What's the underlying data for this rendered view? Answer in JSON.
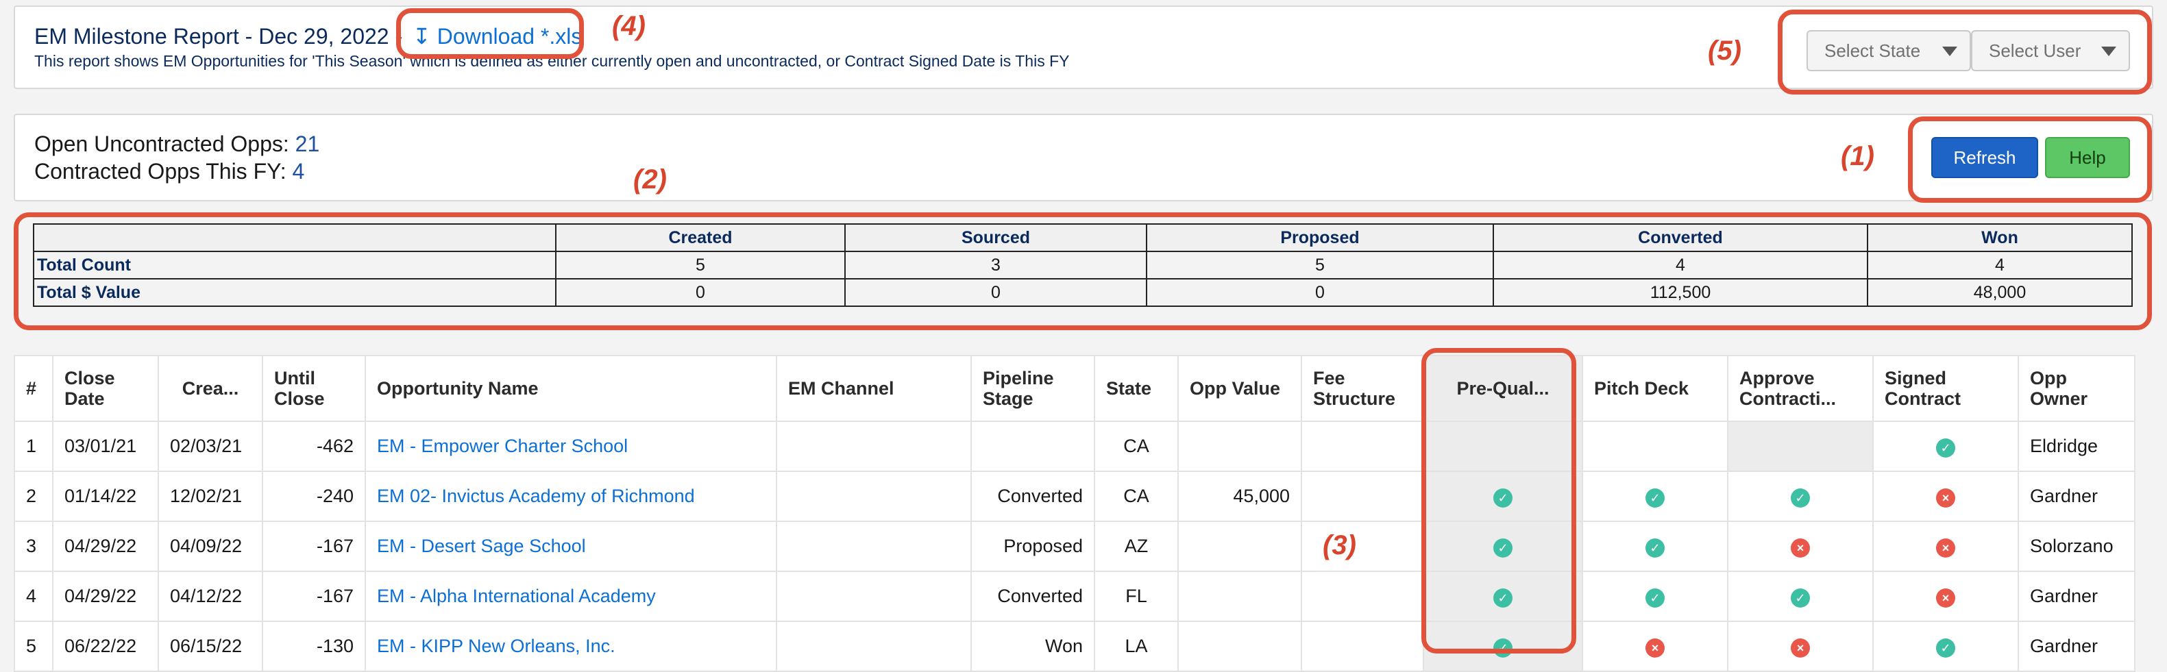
{
  "header": {
    "title": "EM Milestone Report - Dec 29, 2022 -",
    "download_label": "Download *.xls",
    "download_icon": "download-arrow-icon",
    "subtitle": "This report shows EM Opportunities for 'This Season' which is defined as either currently open and uncontracted, or Contract Signed Date is This FY",
    "state_select": "Select State",
    "user_select": "Select User"
  },
  "annotations": {
    "a1": "(1)",
    "a2": "(2)",
    "a3": "(3)",
    "a4": "(4)",
    "a5": "(5)"
  },
  "summary": {
    "open_label": "Open Uncontracted Opps:",
    "open_value": "21",
    "contracted_label": "Contracted Opps This FY:",
    "contracted_value": "4",
    "refresh_label": "Refresh",
    "help_label": "Help"
  },
  "milestones": {
    "headers": [
      "Created",
      "Sourced",
      "Proposed",
      "Converted",
      "Won"
    ],
    "rows": [
      {
        "label": "Total Count",
        "values": [
          "5",
          "3",
          "5",
          "4",
          "4"
        ]
      },
      {
        "label": "Total $ Value",
        "values": [
          "0",
          "0",
          "0",
          "112,500",
          "48,000"
        ]
      }
    ]
  },
  "opps": {
    "headers": [
      "#",
      "Close Date",
      "Crea...",
      "Until Close",
      "Opportunity Name",
      "EM Channel",
      "Pipeline Stage",
      "State",
      "Opp Value",
      "Fee Structure",
      "Pre-Qual...",
      "Pitch Deck",
      "Approve Contracti...",
      "Signed Contract",
      "Opp Owner"
    ],
    "rows": [
      {
        "n": "1",
        "close": "03/01/21",
        "created": "02/03/21",
        "until": "-462",
        "name": "EM - Empower Charter School",
        "channel": "",
        "stage": "",
        "state": "CA",
        "value": "",
        "fee": "",
        "prequal": "",
        "pitch": "",
        "approve": "",
        "signed": "ok",
        "owner": "Eldridge"
      },
      {
        "n": "2",
        "close": "01/14/22",
        "created": "12/02/21",
        "until": "-240",
        "name": "EM 02- Invictus Academy of Richmond",
        "channel": "",
        "stage": "Converted",
        "state": "CA",
        "value": "45,000",
        "fee": "",
        "prequal": "ok",
        "pitch": "ok",
        "approve": "ok",
        "signed": "no",
        "owner": "Gardner"
      },
      {
        "n": "3",
        "close": "04/29/22",
        "created": "04/09/22",
        "until": "-167",
        "name": "EM - Desert Sage School",
        "channel": "",
        "stage": "Proposed",
        "state": "AZ",
        "value": "",
        "fee": "",
        "prequal": "ok",
        "pitch": "ok",
        "approve": "no",
        "signed": "no",
        "owner": "Solorzano"
      },
      {
        "n": "4",
        "close": "04/29/22",
        "created": "04/12/22",
        "until": "-167",
        "name": "EM - Alpha International Academy",
        "channel": "",
        "stage": "Converted",
        "state": "FL",
        "value": "",
        "fee": "",
        "prequal": "ok",
        "pitch": "ok",
        "approve": "ok",
        "signed": "no",
        "owner": "Gardner"
      },
      {
        "n": "5",
        "close": "06/22/22",
        "created": "06/15/22",
        "until": "-130",
        "name": "EM - KIPP New Orleans, Inc.",
        "channel": "",
        "stage": "Won",
        "state": "LA",
        "value": "",
        "fee": "",
        "prequal": "ok",
        "pitch": "no",
        "approve": "no",
        "signed": "ok",
        "owner": "Gardner"
      }
    ]
  },
  "colors": {
    "highlight": "#e0533a",
    "link": "#0b6fd6",
    "refresh": "#1e63c6",
    "help": "#5cc764",
    "ok": "#3dbfa3",
    "no": "#e8574a"
  }
}
